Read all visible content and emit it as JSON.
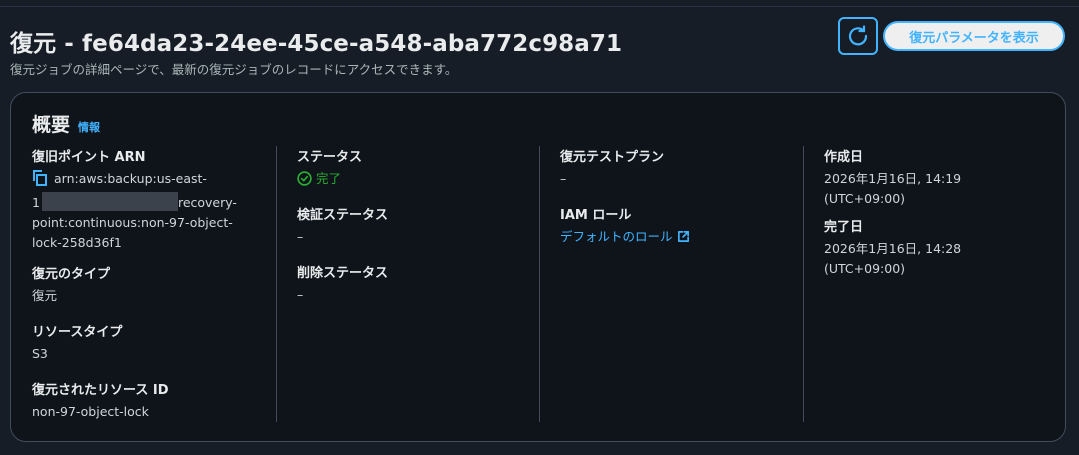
{
  "header": {
    "title": "復元 - fe64da23-24ee-45ce-a548-aba772c98a71",
    "subtitle": "復元ジョブの詳細ページで、最新の復元ジョブのレコードにアクセスできます。",
    "refresh_icon": "refresh-icon",
    "params_button": "復元パラメータを表示"
  },
  "overview": {
    "title": "概要",
    "info_link": "情報",
    "columns": [
      {
        "fields": [
          {
            "label": "復旧ポイント ARN",
            "value_line1": "arn:aws:backup:us-east-",
            "value_line2_prefix": "1",
            "value_line2_suffix": "recovery-",
            "value_line3": "point:continuous:non-97-object-",
            "value_line4": "lock-258d36f1"
          },
          {
            "label": "復元のタイプ",
            "value": "復元"
          },
          {
            "label": "リソースタイプ",
            "value": "S3"
          },
          {
            "label": "復元されたリソース ID",
            "value": "non-97-object-lock"
          }
        ]
      },
      {
        "fields": [
          {
            "label": "ステータス",
            "value": "完了",
            "status_color": "#29ad32"
          },
          {
            "label": "検証ステータス",
            "value": "–"
          },
          {
            "label": "削除ステータス",
            "value": "–"
          }
        ]
      },
      {
        "fields": [
          {
            "label": "復元テストプラン",
            "value": "–"
          },
          {
            "label": "IAM ロール",
            "value": "デフォルトのロール"
          }
        ]
      },
      {
        "fields": [
          {
            "label": "作成日",
            "value_line1": "2026年1月16日, 14:19",
            "value_line2": "(UTC+09:00)"
          },
          {
            "label": "完了日",
            "value_line1": "2026年1月16日, 14:28",
            "value_line2": "(UTC+09:00)"
          }
        ]
      }
    ]
  },
  "colors": {
    "accent": "#42b4ff",
    "success": "#29ad32",
    "background": "#161d26",
    "panel": "#0f141a"
  }
}
